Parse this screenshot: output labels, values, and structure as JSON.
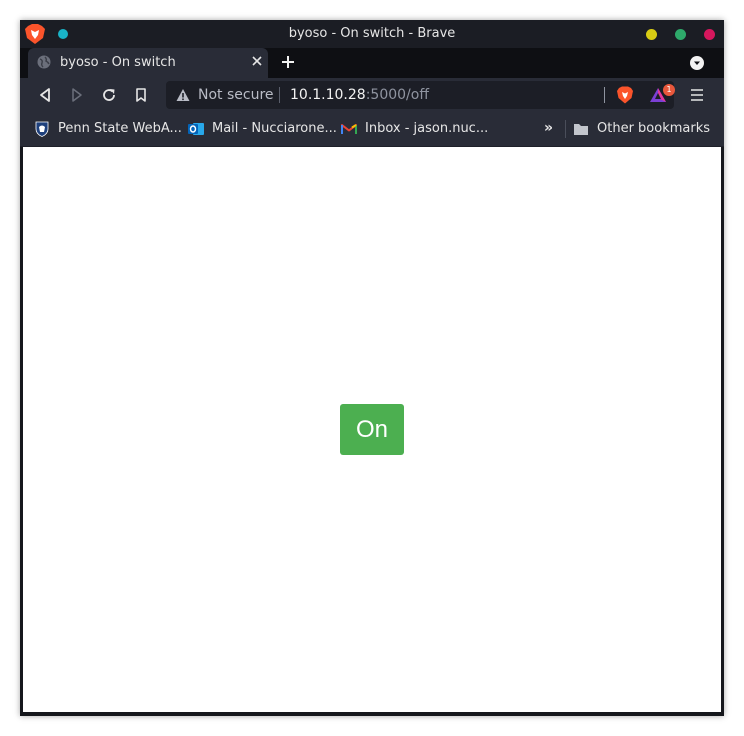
{
  "window": {
    "title": "byoso - On switch - Brave"
  },
  "tab": {
    "title": "byoso - On switch",
    "favicon": "globe-icon"
  },
  "toolbar": {
    "security_label": "Not secure",
    "url_host": "10.1.10.28",
    "url_rest": ":5000/off",
    "rewards_badge": "1"
  },
  "bookmarks": {
    "items": [
      {
        "label": "Penn State WebA...",
        "icon": "penn-state-shield-icon"
      },
      {
        "label": "Mail - Nucciarone...",
        "icon": "outlook-icon"
      },
      {
        "label": "Inbox - jason.nuc...",
        "icon": "gmail-icon"
      }
    ],
    "more": "»",
    "other": "Other bookmarks"
  },
  "page": {
    "button_label": "On",
    "button_color": "#4caf50"
  },
  "colors": {
    "brave_orange": "#fb542b",
    "wm_minimize": "#d8cc14",
    "wm_maximize": "#2ea96a",
    "wm_close": "#d6175d",
    "pin_dot": "#19b3c7"
  }
}
